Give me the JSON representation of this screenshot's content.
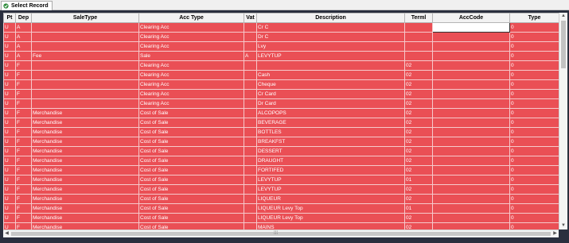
{
  "tab": {
    "label": "Select Record",
    "icon": "select-record-icon"
  },
  "columns": [
    "Pt",
    "Dep",
    "SaleType",
    "Acc Type",
    "Vat",
    "Description",
    "Terml",
    "AccCode",
    "Type"
  ],
  "rows": [
    [
      "U",
      "A",
      "",
      "Clearing Acc",
      "",
      "Cr C",
      "",
      "",
      "0"
    ],
    [
      "U",
      "A",
      "",
      "Clearing Acc",
      "",
      "Dr C",
      "",
      "",
      "0"
    ],
    [
      "U",
      "A",
      "",
      "Clearing Acc",
      "",
      "Lvy",
      "",
      "",
      "0"
    ],
    [
      "U",
      "A",
      "Fee",
      "Sale",
      "A",
      "LEVYTUP",
      "",
      "",
      "0"
    ],
    [
      "U",
      "F",
      "",
      "Clearing Acc",
      "",
      "",
      "02",
      "",
      "0"
    ],
    [
      "U",
      "F",
      "",
      "Clearing Acc",
      "",
      "Cash",
      "02",
      "",
      "0"
    ],
    [
      "U",
      "F",
      "",
      "Clearing Acc",
      "",
      "Cheque",
      "02",
      "",
      "0"
    ],
    [
      "U",
      "F",
      "",
      "Clearing Acc",
      "",
      "Cr Card",
      "02",
      "",
      "0"
    ],
    [
      "U",
      "F",
      "",
      "Clearing Acc",
      "",
      "Dr Card",
      "02",
      "",
      "0"
    ],
    [
      "U",
      "F",
      "Merchandise",
      "Cost of Sale",
      "",
      "ALCOPOPS",
      "02",
      "",
      "0"
    ],
    [
      "U",
      "F",
      "Merchandise",
      "Cost of Sale",
      "",
      "BEVERAGE",
      "02",
      "",
      "0"
    ],
    [
      "U",
      "F",
      "Merchandise",
      "Cost of Sale",
      "",
      "BOTTLES",
      "02",
      "",
      "0"
    ],
    [
      "U",
      "F",
      "Merchandise",
      "Cost of Sale",
      "",
      "BREAKFST",
      "02",
      "",
      "0"
    ],
    [
      "U",
      "F",
      "Merchandise",
      "Cost of Sale",
      "",
      "DESSERT",
      "02",
      "",
      "0"
    ],
    [
      "U",
      "F",
      "Merchandise",
      "Cost of Sale",
      "",
      "DRAUGHT",
      "02",
      "",
      "0"
    ],
    [
      "U",
      "F",
      "Merchandise",
      "Cost of Sale",
      "",
      "FORTIFED",
      "02",
      "",
      "0"
    ],
    [
      "U",
      "F",
      "Merchandise",
      "Cost of Sale",
      "",
      "LEVYTUP",
      "01",
      "",
      "0"
    ],
    [
      "U",
      "F",
      "Merchandise",
      "Cost of Sale",
      "",
      "LEVYTUP",
      "02",
      "",
      "0"
    ],
    [
      "U",
      "F",
      "Merchandise",
      "Cost of Sale",
      "",
      "LIQUEUR",
      "02",
      "",
      "0"
    ],
    [
      "U",
      "F",
      "Merchandise",
      "Cost of Sale",
      "",
      "LIQUEUR Levy Top",
      "01",
      "",
      "0"
    ],
    [
      "U",
      "F",
      "Merchandise",
      "Cost of Sale",
      "",
      "LIQUEUR Levy Top",
      "02",
      "",
      "0"
    ],
    [
      "U",
      "F",
      "Merchandise",
      "Cost of Sale",
      "",
      "MAINS",
      "02",
      "",
      "0"
    ]
  ],
  "colors": {
    "row_bg": "#ea4f55",
    "frame": "#2a2f3e",
    "row_text": "#ffffff"
  }
}
